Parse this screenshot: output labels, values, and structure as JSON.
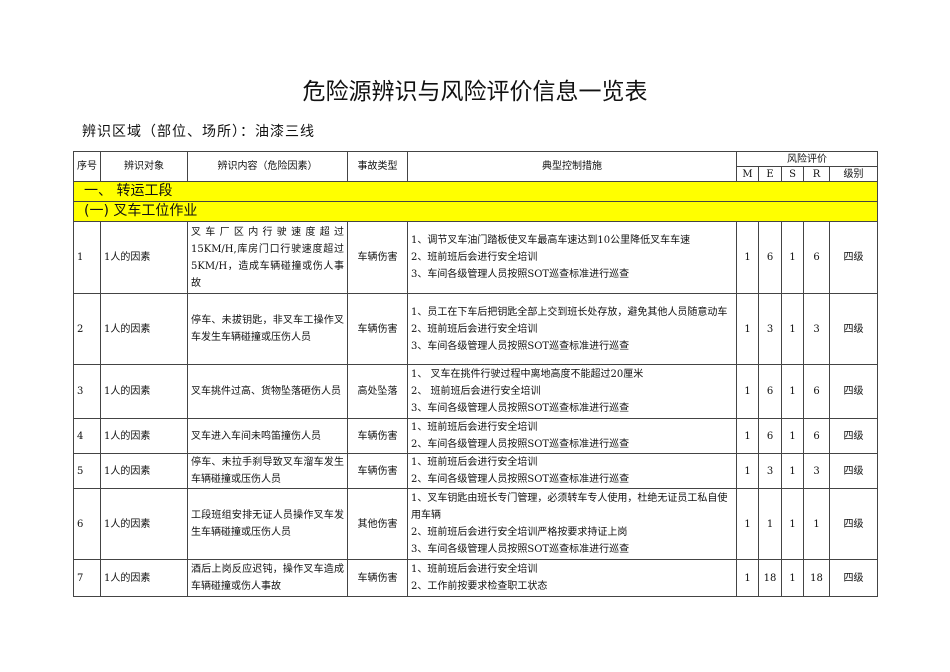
{
  "title": "危险源辨识与风险评价信息一览表",
  "area": "辨识区域（部位、场所）：油漆三线",
  "headers": {
    "no": "序号",
    "target": "辨识对象",
    "content": "辨识内容（危险因素）",
    "type": "事故类型",
    "measures": "典型控制措施",
    "risk": "风险评价",
    "M": "M",
    "E": "E",
    "S": "S",
    "R": "R",
    "level": "级别"
  },
  "sections": {
    "s1": "一、  转运工段",
    "s2": "(一)   叉车工位作业"
  },
  "rows": [
    {
      "no": "1",
      "target": "1人的因素",
      "content": "叉车厂区内行驶速度超过15KM/H,库房门口行驶速度超过5KM/H，造成车辆碰撞或伤人事故",
      "type": "车辆伤害",
      "measures": [
        "1、调节叉车油门踏板使叉车最高车速达到10公里降低叉车车速",
        "2、班前班后会进行安全培训",
        "3、车间各级管理人员按照SOT巡查标准进行巡查"
      ],
      "M": "1",
      "E": "6",
      "S": "1",
      "R": "6",
      "level": "四级"
    },
    {
      "no": "2",
      "target": "1人的因素",
      "content": "停车、未拔钥匙，非叉车工操作叉车发生车辆碰撞或压伤人员",
      "type": "车辆伤害",
      "measures": [
        "1、员工在下车后把钥匙全部上交到班长处存放，避免其他人员随意动车",
        "2、班前班后会进行安全培训",
        "3、车间各级管理人员按照SOT巡查标准进行巡查"
      ],
      "M": "1",
      "E": "3",
      "S": "1",
      "R": "3",
      "level": "四级"
    },
    {
      "no": "3",
      "target": "1人的因素",
      "content": "叉车挑件过高、货物坠落砸伤人员",
      "type": "高处坠落",
      "measures": [
        "1、 叉车在挑件行驶过程中离地高度不能超过20厘米",
        "2、 班前班后会进行安全培训",
        "3、车间各级管理人员按照SOT巡查标准进行巡查"
      ],
      "M": "1",
      "E": "6",
      "S": "1",
      "R": "6",
      "level": "四级"
    },
    {
      "no": "4",
      "target": "1人的因素",
      "content": "叉车进入车间未鸣笛撞伤人员",
      "type": "车辆伤害",
      "measures": [
        "1、班前班后会进行安全培训",
        "2、车间各级管理人员按照SOT巡查标准进行巡查"
      ],
      "M": "1",
      "E": "6",
      "S": "1",
      "R": "6",
      "level": "四级"
    },
    {
      "no": "5",
      "target": "1人的因素",
      "content": "停车、未拉手刹导致叉车溜车发生车辆碰撞或压伤人员",
      "type": "车辆伤害",
      "measures": [
        "1、班前班后会进行安全培训",
        "2、车间各级管理人员按照SOT巡查标准进行巡查"
      ],
      "M": "1",
      "E": "3",
      "S": "1",
      "R": "3",
      "level": "四级"
    },
    {
      "no": "6",
      "target": "1人的因素",
      "content": "工段班组安排无证人员操作叉车发生车辆碰撞或压伤人员",
      "type": "其他伤害",
      "measures": [
        "1、叉车钥匙由班长专门管理，必须转车专人使用，杜绝无证员工私自使用车辆",
        "2、班前班后会进行安全培训严格按要求持证上岗",
        "3、车间各级管理人员按照SOT巡查标准进行巡查"
      ],
      "M": "1",
      "E": "1",
      "S": "1",
      "R": "1",
      "level": "四级"
    },
    {
      "no": "7",
      "target": "1人的因素",
      "content": "酒后上岗反应迟钝，操作叉车造成车辆碰撞或伤人事故",
      "type": "车辆伤害",
      "measures": [
        "1、班前班后会进行安全培训",
        "2、工作前按要求检查职工状态"
      ],
      "M": "1",
      "E": "18",
      "S": "1",
      "R": "18",
      "level": "四级"
    }
  ]
}
